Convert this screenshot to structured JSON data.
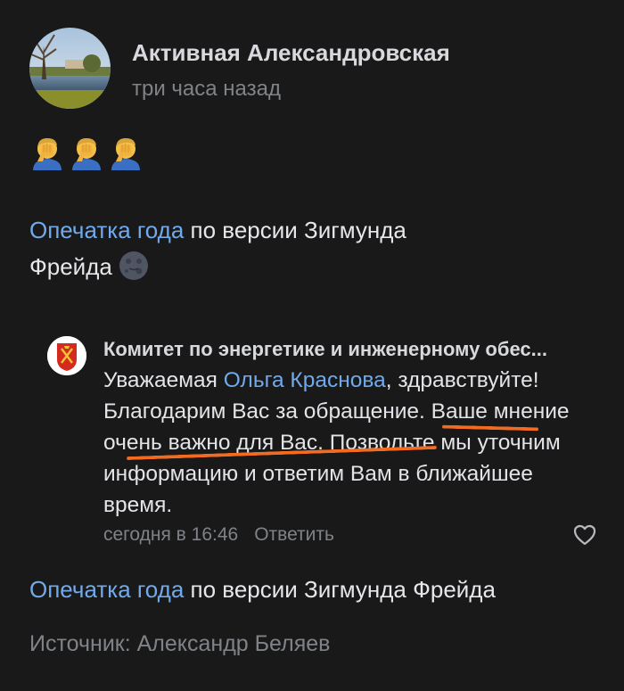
{
  "post": {
    "author": "Активная Александровская",
    "time": "три часа назад",
    "emojis": [
      "face-palm-icon",
      "face-palm-icon",
      "face-palm-icon"
    ],
    "text_link": "Опечатка года",
    "text_rest_line1": " по версии Зигмунда",
    "text_rest_line2": "Фрейда",
    "text_emoji": "new-moon-face-icon"
  },
  "comment": {
    "author": "Комитет по энергетике и инженерному обес...",
    "text_part1": "Уважаемая ",
    "mention": "Ольга Краснова",
    "text_part2": ", здравствуйте! Благодарим Вас за обращение. Ваше мнение очень важно для Вас. Позвольте мы уточним информацию и ответим Вам в ближайшее время.",
    "date": "сегодня в 16:46",
    "reply_label": "Ответить",
    "like_icon": "heart-outline-icon"
  },
  "annotation": {
    "color": "#f26b21",
    "note": "orange underline marks"
  },
  "footer": {
    "link": "Опечатка года",
    "rest": " по версии Зигмунда Фрейда",
    "source": "Источник: Александр Беляев"
  },
  "colors": {
    "background": "#19191a",
    "link": "#71aaeb",
    "muted": "#7f8388",
    "text": "#e1e3e6"
  }
}
